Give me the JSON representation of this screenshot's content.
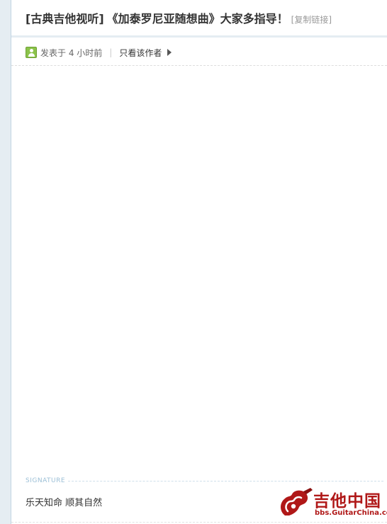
{
  "thread": {
    "category": "[古典吉他视听]",
    "title": "《加泰罗尼亚随想曲》大家多指导！",
    "copy_link": "[复制链接]"
  },
  "meta": {
    "posted": "发表于 4 小时前",
    "separator": "|",
    "author_only": "只看该作者"
  },
  "signature": {
    "label": "SIGNATURE",
    "text": "乐天知命 顺其自然"
  },
  "watermark": {
    "name_cn": "吉他中国",
    "url": "bbs.GuitarChina.com"
  },
  "colors": {
    "rail": "#e5edf2",
    "accent_green": "#8bc34a",
    "watermark_red": "#b01818"
  }
}
